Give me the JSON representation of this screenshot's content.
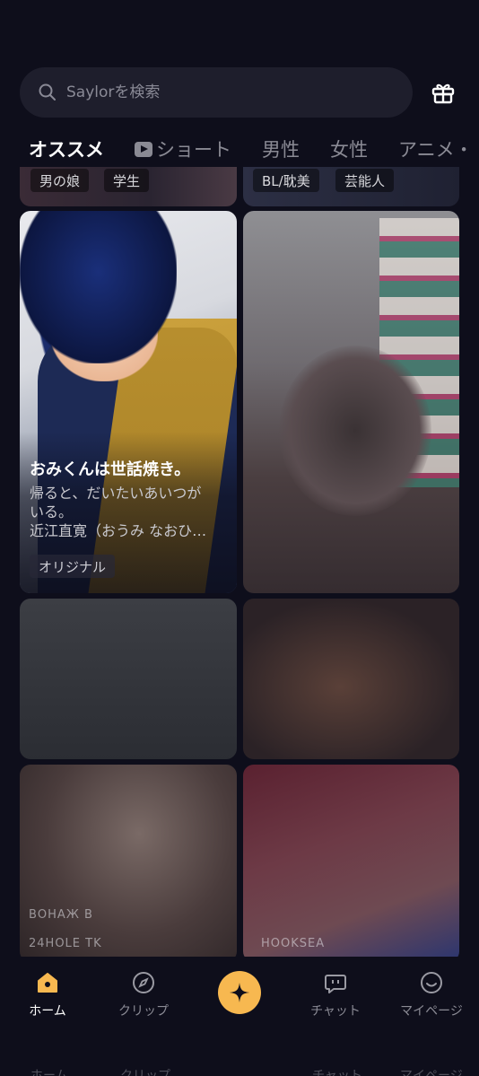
{
  "search": {
    "placeholder": "Saylorを検索"
  },
  "tabs": [
    {
      "label": "オススメ"
    },
    {
      "label": "ショート"
    },
    {
      "label": "男性"
    },
    {
      "label": "女性"
    },
    {
      "label": "アニメ・"
    }
  ],
  "prev_row": {
    "left_tags": [
      "男の娘",
      "学生"
    ],
    "right_tags": [
      "BL/耽美",
      "芸能人"
    ]
  },
  "featured": {
    "title": "おみくんは世話焼き。",
    "desc_lines": [
      "帰ると、だいたいあいつが",
      "いる。",
      "近江直寛（おうみ なおひ…"
    ],
    "tag": "オリジナル"
  },
  "blurred_captions": {
    "c5_top": "ВОНАЖ В",
    "c5_bottom": "24HOLE TK",
    "c6_bottom": "HOOKSEA"
  },
  "nav": {
    "items": [
      {
        "label": "ホーム",
        "icon": "home-icon"
      },
      {
        "label": "クリップ",
        "icon": "compass-icon"
      },
      {
        "label": "",
        "icon": "sparkle-icon"
      },
      {
        "label": "チャット",
        "icon": "chat-icon"
      },
      {
        "label": "マイページ",
        "icon": "smile-icon"
      }
    ],
    "ghost_labels": [
      "ホーム",
      "クリップ",
      "チャット",
      "マイページ"
    ]
  },
  "colors": {
    "accent": "#f7b850",
    "background": "#0e0e1b"
  }
}
